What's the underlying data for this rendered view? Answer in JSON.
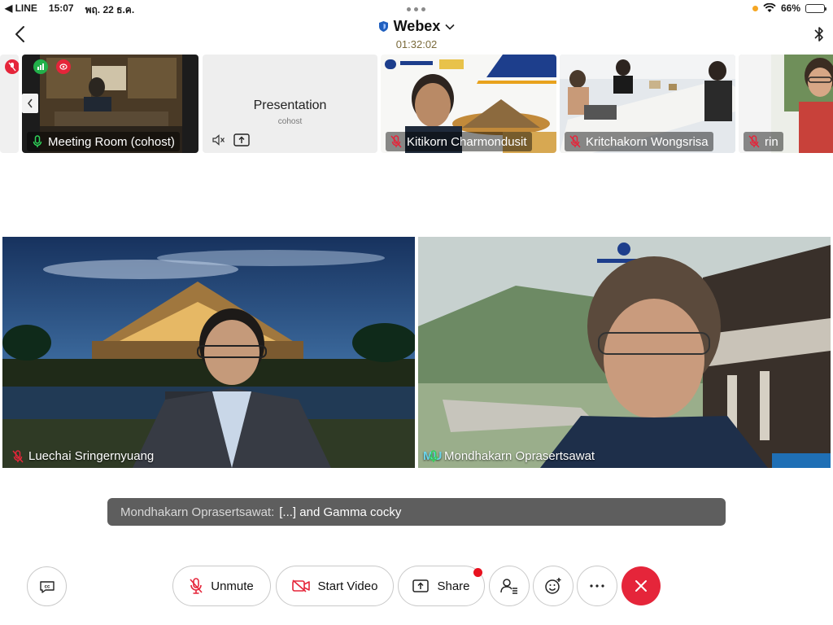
{
  "statusbar": {
    "back_app": "◀ LINE",
    "time": "15:07",
    "date": "พฤ. 22 ธ.ค.",
    "battery": "66%"
  },
  "header": {
    "title": "Webex",
    "timer": "01:32:02"
  },
  "thumbnails": [
    {
      "name": "Meeting Room (cohost)",
      "mic": "on"
    },
    {
      "name": "Presentation",
      "sub": "cohost"
    },
    {
      "name": "Kitikorn Charmondusit",
      "mic": "muted"
    },
    {
      "name": "Kritchakorn Wongsrisa",
      "mic": "muted"
    },
    {
      "name": "rin",
      "mic": "muted"
    }
  ],
  "main": [
    {
      "name": "Luechai Sringernyuang",
      "mic": "muted"
    },
    {
      "name": "Mondhakarn Oprasertsawat",
      "mic": "on",
      "overlay": "MU"
    }
  ],
  "caption": {
    "speaker": "Mondhakarn Oprasertsawat:",
    "text": "[...] and Gamma cocky"
  },
  "controls": {
    "unmute": "Unmute",
    "start_video": "Start Video",
    "share": "Share"
  },
  "colors": {
    "end_call": "#e5253a",
    "caption_bg": "#5e5e5e",
    "muted_icon": "#e5253a"
  }
}
